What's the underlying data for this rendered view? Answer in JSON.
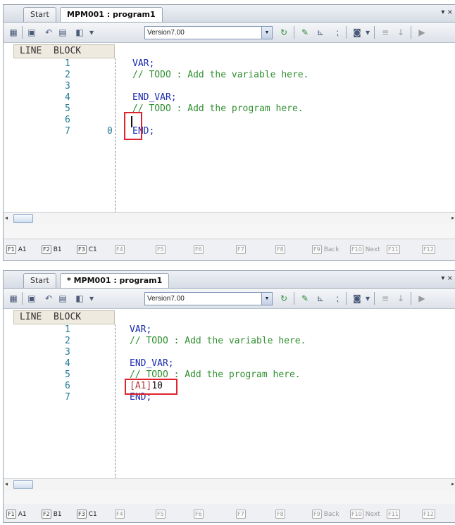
{
  "panel_top": {
    "tabs": [
      "Start",
      "MPM001 : program1"
    ],
    "tab_controls": "▾ ×",
    "toolbar": {
      "version": "Version7.00"
    },
    "editor": {
      "header_line": "LINE",
      "header_block": "BLOCK",
      "line_numbers": [
        "1",
        "2",
        "3",
        "4",
        "5",
        "6",
        "7"
      ],
      "block_numbers": [
        "",
        "",
        "",
        "",
        "",
        "",
        "0"
      ],
      "lines": [
        {
          "kw": "VAR;",
          "cm": ""
        },
        {
          "kw": "",
          "cm": "// TODO : Add the variable here."
        },
        {
          "kw": "",
          "cm": ""
        },
        {
          "kw": "END_VAR;",
          "cm": ""
        },
        {
          "kw": "",
          "cm": "// TODO : Add the program here."
        },
        {
          "kw": "",
          "cm": ""
        },
        {
          "kw": "END;",
          "cm": ""
        }
      ]
    }
  },
  "panel_bottom": {
    "tabs": [
      "Start",
      "* MPM001 : program1"
    ],
    "tab_controls": "▾ ×",
    "toolbar": {
      "version": "Version7.00"
    },
    "editor": {
      "header_line": "LINE",
      "header_block": "BLOCK",
      "line_numbers": [
        "1",
        "2",
        "3",
        "4",
        "5",
        "6",
        "7"
      ],
      "lines": [
        {
          "kw": "VAR;",
          "cm": ""
        },
        {
          "kw": "",
          "cm": "// TODO : Add the variable here."
        },
        {
          "kw": "",
          "cm": ""
        },
        {
          "kw": "END_VAR;",
          "cm": ""
        },
        {
          "kw": "",
          "cm": "// TODO : Add the program here."
        },
        {
          "kw": "",
          "cm": ""
        },
        {
          "kw": "END;",
          "cm": ""
        }
      ],
      "inserted_label": "[A1]",
      "inserted_value": "10"
    }
  },
  "fkeys": [
    {
      "key": "F1",
      "label": "A1"
    },
    {
      "key": "F2",
      "label": "B1"
    },
    {
      "key": "F3",
      "label": "C1"
    },
    {
      "key": "F4",
      "label": ""
    },
    {
      "key": "F5",
      "label": ""
    },
    {
      "key": "F6",
      "label": ""
    },
    {
      "key": "F7",
      "label": ""
    },
    {
      "key": "F8",
      "label": ""
    },
    {
      "key": "F9",
      "label": "Back"
    },
    {
      "key": "F10",
      "label": "Next"
    },
    {
      "key": "F11",
      "label": ""
    },
    {
      "key": "F12",
      "label": ""
    }
  ],
  "colors": {
    "keyword": "#1a2bb0",
    "comment": "#2f8f2f",
    "line_number": "#217a96",
    "highlight": "#e0232d"
  }
}
